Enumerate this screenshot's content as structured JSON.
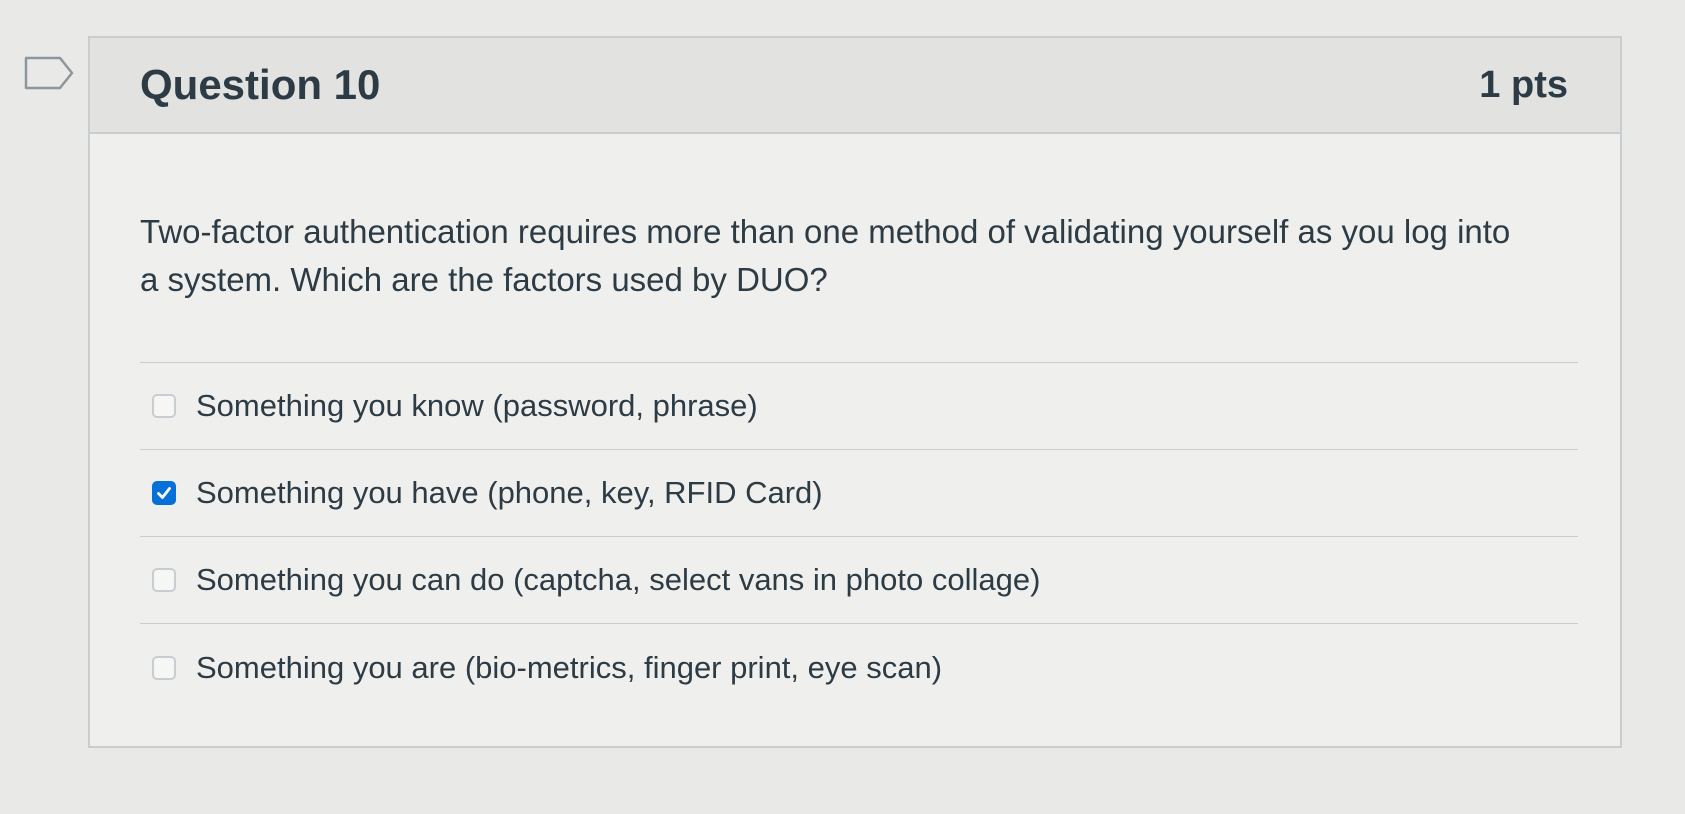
{
  "question": {
    "title": "Question 10",
    "points": "1 pts",
    "text": "Two-factor authentication requires more than one method of validating yourself as you log into a system. Which are the factors used by DUO?",
    "answers": [
      {
        "label": "Something you know (password, phrase)",
        "checked": false
      },
      {
        "label": "Something you have (phone, key, RFID Card)",
        "checked": true
      },
      {
        "label": "Something you can do (captcha, select vans in photo collage)",
        "checked": false
      },
      {
        "label": "Something you are (bio-metrics, finger print, eye scan)",
        "checked": false
      }
    ]
  },
  "icons": {
    "flag": "flag-question-icon",
    "check": "checkmark-icon"
  },
  "colors": {
    "accent": "#0770d8",
    "text": "#2d3b45",
    "border": "#c7cdd1",
    "header_bg": "#e2e2e1"
  }
}
